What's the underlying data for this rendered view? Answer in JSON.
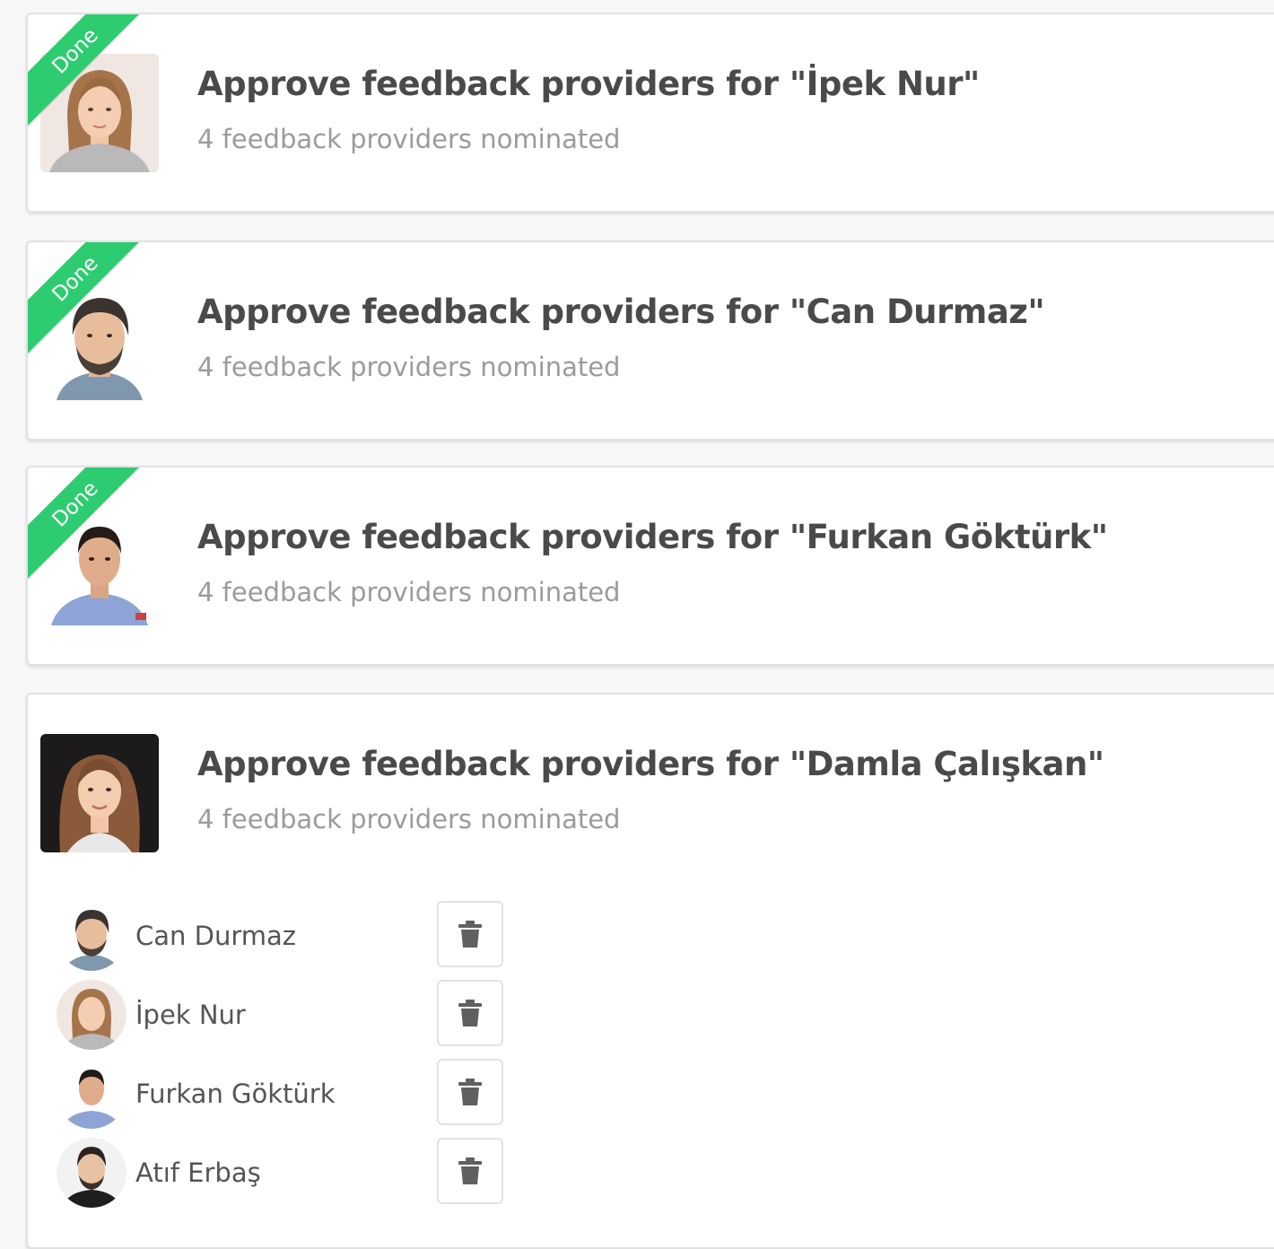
{
  "tasks": [
    {
      "status": "Done",
      "title": "Approve feedback providers for \"İpek Nur\"",
      "subtitle": "4 feedback providers nominated"
    },
    {
      "status": "Done",
      "title": "Approve feedback providers for \"Can Durmaz\"",
      "subtitle": "4 feedback providers nominated"
    },
    {
      "status": "Done",
      "title": "Approve feedback providers for \"Furkan Göktürk\"",
      "subtitle": "4 feedback providers nominated"
    },
    {
      "status": "",
      "title": "Approve feedback providers for \"Damla Çalışkan\"",
      "subtitle": "4 feedback providers nominated",
      "nominees": [
        {
          "name": "Can Durmaz"
        },
        {
          "name": "İpek Nur"
        },
        {
          "name": "Furkan Göktürk"
        },
        {
          "name": "Atıf Erbaş"
        }
      ]
    }
  ],
  "colors": {
    "done_ribbon": "#2ecc71",
    "title": "#4a4a4a",
    "subtitle": "#9b9b9b"
  },
  "icons": {
    "delete": "trash-icon"
  }
}
